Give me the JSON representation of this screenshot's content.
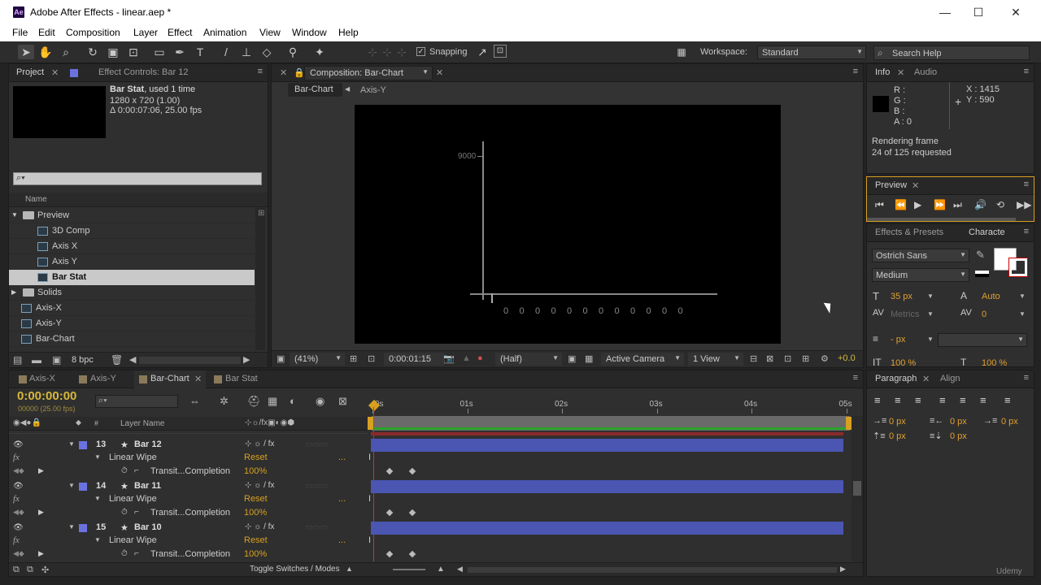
{
  "window": {
    "title": "Adobe After Effects - linear.aep *",
    "logo": "Ae"
  },
  "menu": [
    "File",
    "Edit",
    "Composition",
    "Layer",
    "Effect",
    "Animation",
    "View",
    "Window",
    "Help"
  ],
  "toolbar": {
    "snapping": "Snapping",
    "workspace_label": "Workspace:",
    "workspace_value": "Standard",
    "search_placeholder": "Search Help"
  },
  "project": {
    "tab_project": "Project",
    "tab_effect": "Effect Controls: Bar 12",
    "item_name": "Bar Stat",
    "item_used": ", used 1 time",
    "item_size": "1280 x 720 (1.00)",
    "item_dur": "Δ 0:00:07:06, 25.00 fps",
    "col_name": "Name",
    "items": [
      {
        "name": "Preview",
        "type": "folder",
        "indent": 0
      },
      {
        "name": "3D Comp",
        "type": "comp",
        "indent": 1
      },
      {
        "name": "Axis X",
        "type": "comp",
        "indent": 1
      },
      {
        "name": "Axis Y",
        "type": "comp",
        "indent": 1
      },
      {
        "name": "Bar Stat",
        "type": "comp",
        "indent": 1,
        "selected": true
      },
      {
        "name": "Solids",
        "type": "folder",
        "indent": 0
      },
      {
        "name": "Axis-X",
        "type": "comp",
        "indent": 0
      },
      {
        "name": "Axis-Y",
        "type": "comp",
        "indent": 0
      },
      {
        "name": "Bar-Chart",
        "type": "comp",
        "indent": 0
      }
    ],
    "bpc": "8 bpc"
  },
  "comp": {
    "tab": "Composition: Bar-Chart",
    "crumb1": "Bar-Chart",
    "crumb2": "Axis-Y",
    "ylabel": "9000",
    "xticks": [
      "0",
      "0",
      "0",
      "0",
      "0",
      "0",
      "0",
      "0",
      "0",
      "0",
      "0",
      "0"
    ],
    "zoom": "(41%)",
    "timecode": "0:00:01:15",
    "resolution": "(Half)",
    "camera": "Active Camera",
    "views": "1 View",
    "exposure": "+0.0"
  },
  "info": {
    "tab_info": "Info",
    "tab_audio": "Audio",
    "r": "R :",
    "g": "G :",
    "b": "B :",
    "a": "A : 0",
    "x": "X : 1415",
    "y": "Y : 590",
    "status1": "Rendering frame",
    "status2": "24 of 125 requested"
  },
  "preview": {
    "tab": "Preview"
  },
  "character": {
    "tab_effects": "Effects & Presets",
    "tab_char": "Characte",
    "font": "Ostrich Sans",
    "style": "Medium",
    "size": "35 px",
    "leading": "Auto",
    "kerning": "Metrics",
    "tracking": "0",
    "stroke": "- px",
    "vscale": "100 %",
    "hscale": "100 %"
  },
  "paragraph": {
    "tab_para": "Paragraph",
    "tab_align": "Align",
    "v1": "0 px",
    "v2": "0 px",
    "v3": "0 px",
    "v4": "0 px",
    "v5": "0 px"
  },
  "timeline": {
    "tabs": [
      "Axis-X",
      "Axis-Y",
      "Bar-Chart",
      "Bar Stat"
    ],
    "timecode": "0:00:00:00",
    "frames": "00000 (25.00 fps)",
    "col_layer": "Layer Name",
    "ruler": [
      "0s",
      "01s",
      "02s",
      "03s",
      "04s",
      "05s"
    ],
    "layers": [
      {
        "num": "13",
        "name": "Bar 12",
        "effect": "Linear Wipe",
        "prop": "Transit...Completion",
        "reset": "Reset",
        "val": "100%"
      },
      {
        "num": "14",
        "name": "Bar 11",
        "effect": "Linear Wipe",
        "prop": "Transit...Completion",
        "reset": "Reset",
        "val": "100%"
      },
      {
        "num": "15",
        "name": "Bar 10",
        "effect": "Linear Wipe",
        "prop": "Transit...Completion",
        "reset": "Reset",
        "val": "100%"
      }
    ],
    "toggle": "Toggle Switches / Modes",
    "fx_label": "fx"
  },
  "watermark": "Udemy"
}
